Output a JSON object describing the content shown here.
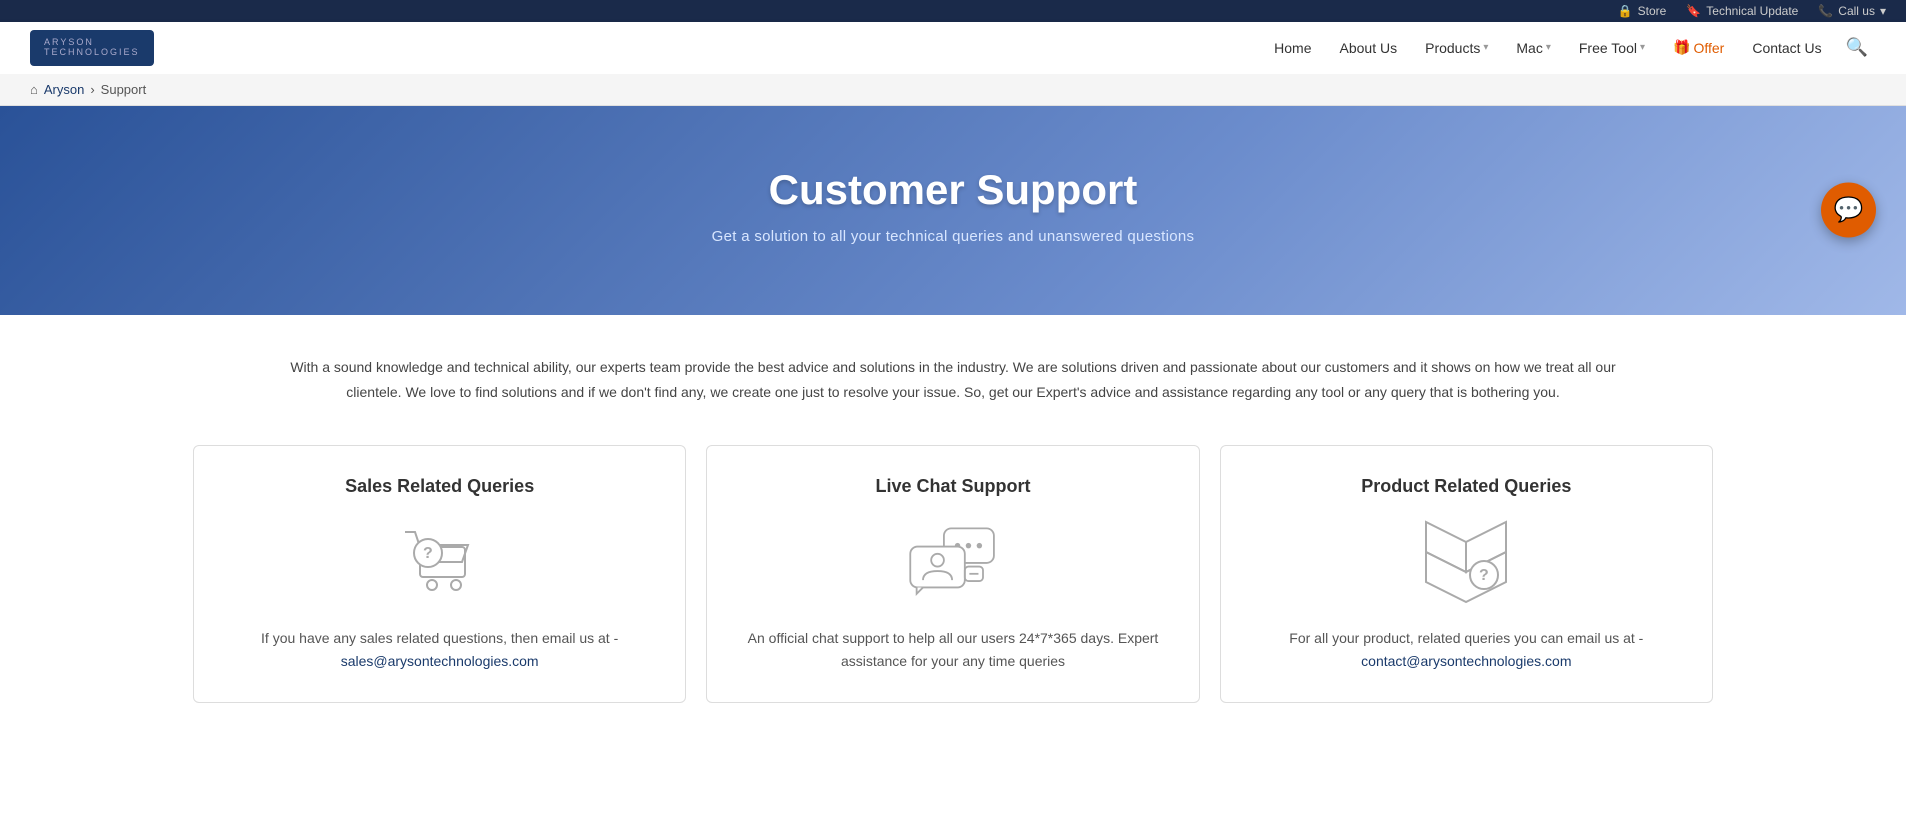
{
  "topbar": {
    "store_label": "Store",
    "technical_update_label": "Technical Update",
    "call_us_label": "Call us",
    "call_us_arrow": "▾"
  },
  "navbar": {
    "logo_line1": "ARYSON",
    "logo_line2": "TECHNOLOGIES",
    "home_label": "Home",
    "about_label": "About Us",
    "products_label": "Products",
    "mac_label": "Mac",
    "free_tool_label": "Free Tool",
    "offer_label": "Offer",
    "contact_label": "Contact Us"
  },
  "breadcrumb": {
    "home_label": "Aryson",
    "separator": "›",
    "current": "Support",
    "home_icon": "⌂"
  },
  "hero": {
    "title": "Customer Support",
    "subtitle": "Get a solution to all your technical queries and unanswered questions"
  },
  "chat_button": {
    "icon": "💬"
  },
  "description": {
    "text": "With a sound knowledge and technical ability, our experts team provide the best advice and solutions in the industry. We are solutions driven and passionate about our customers and it shows on how we treat all our clientele. We love to find solutions and if we don't find any, we create one just to resolve your issue. So, get our Expert's advice and assistance regarding any tool or any query that is bothering you."
  },
  "cards": [
    {
      "title": "Sales Related Queries",
      "text_before": "If you have any sales related questions, then email us at -",
      "email": "sales@arysontechnologies.com",
      "email_href": "mailto:sales@arysontechnologies.com"
    },
    {
      "title": "Live Chat Support",
      "text_before": "An official chat support to help all our users 24*7*365 days. Expert assistance for your any time queries",
      "email": "",
      "email_href": ""
    },
    {
      "title": "Product Related Queries",
      "text_before": "For all your product, related queries you can email us at -",
      "email": "contact@arysontechnologies.com",
      "email_href": "mailto:contact@arysontechnologies.com"
    }
  ]
}
